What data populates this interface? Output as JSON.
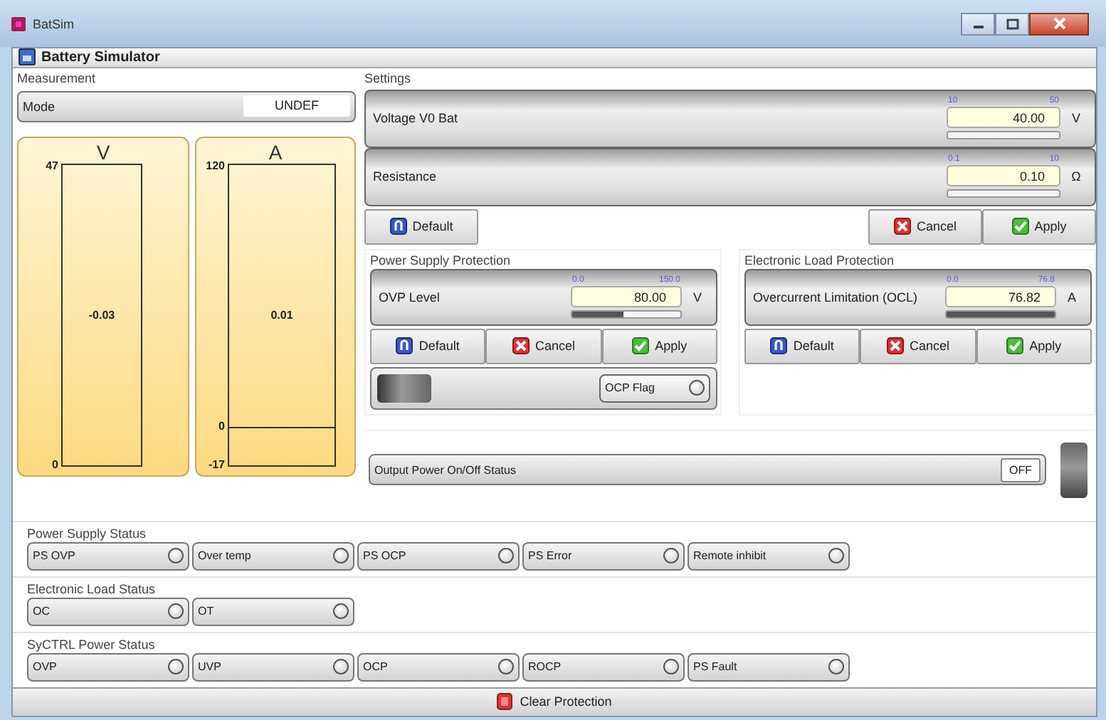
{
  "window": {
    "title": "BatSim"
  },
  "header": {
    "title": "Battery Simulator"
  },
  "measurement": {
    "title": "Measurement",
    "mode": {
      "label": "Mode",
      "value": "UNDEF"
    },
    "meters": [
      {
        "unit": "V",
        "max": "47",
        "min": "0",
        "reading": "-0.03"
      },
      {
        "unit": "A",
        "max": "120",
        "min": "-17",
        "zero": "0",
        "reading": "0.01"
      }
    ]
  },
  "settings": {
    "title": "Settings",
    "fields": [
      {
        "label": "Voltage V0 Bat",
        "min": "10",
        "max": "50",
        "value": "40.00",
        "unit": "V",
        "level": 0
      },
      {
        "label": "Resistance",
        "min": "0.1",
        "max": "10",
        "value": "0.10",
        "unit": "Ω",
        "level": 0
      }
    ],
    "buttons": [
      {
        "kind": "default",
        "label": "Default"
      },
      {
        "kind": "cancel",
        "label": "Cancel"
      },
      {
        "kind": "apply",
        "label": "Apply"
      }
    ]
  },
  "power_supply_protection": {
    "title": "Power Supply Protection",
    "field": {
      "label": "OVP Level",
      "min": "0.0",
      "max": "150.0",
      "value": "80.00",
      "unit": "V",
      "level": 0.47
    },
    "buttons": [
      {
        "kind": "default",
        "label": "Default"
      },
      {
        "kind": "cancel",
        "label": "Cancel"
      },
      {
        "kind": "apply",
        "label": "Apply"
      }
    ],
    "switch": {
      "on": false
    },
    "ocp_flag": {
      "label": "OCP Flag",
      "on": false
    }
  },
  "electronic_load_protection": {
    "title": "Electronic Load Protection",
    "field": {
      "label": "Overcurrent Limitation (OCL)",
      "min": "0.0",
      "max": "76.8",
      "value": "76.82",
      "unit": "A",
      "level": 1
    },
    "buttons": [
      {
        "kind": "default",
        "label": "Default"
      },
      {
        "kind": "cancel",
        "label": "Cancel"
      },
      {
        "kind": "apply",
        "label": "Apply"
      }
    ]
  },
  "output_power": {
    "label": "Output Power On/Off Status",
    "value": "OFF",
    "on": false
  },
  "status_groups": [
    {
      "title": "Power Supply Status",
      "items": [
        {
          "label": "PS OVP",
          "on": false
        },
        {
          "label": "Over temp",
          "on": false
        },
        {
          "label": "PS OCP",
          "on": false
        },
        {
          "label": "PS Error",
          "on": false
        },
        {
          "label": "Remote inhibit",
          "on": false
        }
      ]
    },
    {
      "title": "Electronic Load Status",
      "items": [
        {
          "label": "OC",
          "on": false
        },
        {
          "label": "OT",
          "on": false
        }
      ]
    },
    {
      "title": "SyCTRL Power Status",
      "items": [
        {
          "label": "OVP",
          "on": false
        },
        {
          "label": "UVP",
          "on": false
        },
        {
          "label": "OCP",
          "on": false
        },
        {
          "label": "ROCP",
          "on": false
        },
        {
          "label": "PS Fault",
          "on": false
        }
      ]
    }
  ],
  "clear_button": {
    "label": "Clear Protection"
  }
}
